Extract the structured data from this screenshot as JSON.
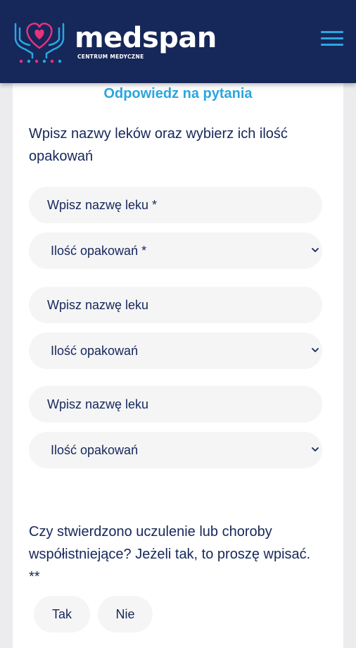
{
  "header": {
    "logo_text": "medspan",
    "logo_subtitle": "CENTRUM MEDYCZNE",
    "colors": {
      "background": "#16275a",
      "accent": "#2aa6e0",
      "logo_pink": "#e8327c"
    }
  },
  "form": {
    "section_title": "Odpowiedz na pytania",
    "question1": "Wpisz nazwy leków oraz wybierz ich ilość opakowań",
    "medicines": [
      {
        "name_placeholder": "Wpisz nazwę leku *",
        "quantity_selected": "Ilość opakowań *"
      },
      {
        "name_placeholder": "Wpisz nazwę leku",
        "quantity_selected": "Ilość opakowań"
      },
      {
        "name_placeholder": "Wpisz nazwę leku",
        "quantity_selected": "Ilość opakowań"
      }
    ],
    "question2": "Czy stwierdzono uczulenie lub choroby współistniejące? Jeżeli tak, to proszę wpisać. **",
    "yes_label": "Tak",
    "no_label": "Nie"
  }
}
